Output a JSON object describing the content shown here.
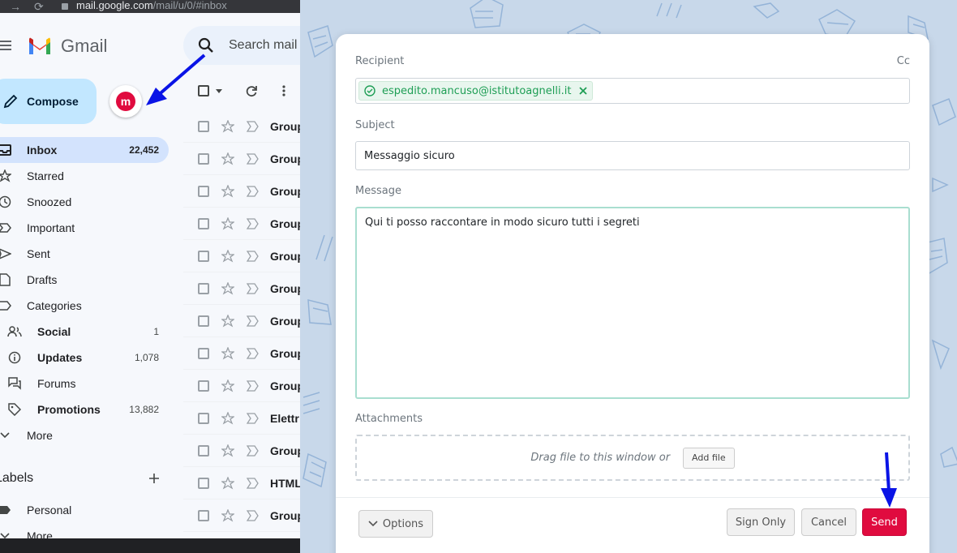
{
  "browser": {
    "url_host": "mail.google.com",
    "url_path": "/mail/u/0/#inbox"
  },
  "gmail": {
    "app_name": "Gmail",
    "search_placeholder": "Search mail",
    "compose_label": "Compose",
    "nav": [
      {
        "label": "Inbox",
        "count": "22,452",
        "icon": "inbox-icon"
      },
      {
        "label": "Starred",
        "count": "",
        "icon": "star-icon"
      },
      {
        "label": "Snoozed",
        "count": "",
        "icon": "clock-icon"
      },
      {
        "label": "Important",
        "count": "",
        "icon": "important-icon"
      },
      {
        "label": "Sent",
        "count": "",
        "icon": "send-icon"
      },
      {
        "label": "Drafts",
        "count": "",
        "icon": "draft-icon"
      },
      {
        "label": "Categories",
        "count": "",
        "icon": "label-icon"
      }
    ],
    "categories": [
      {
        "label": "Social",
        "count": "1",
        "icon": "people-icon"
      },
      {
        "label": "Updates",
        "count": "1,078",
        "icon": "info-icon"
      },
      {
        "label": "Forums",
        "count": "",
        "icon": "forum-icon"
      },
      {
        "label": "Promotions",
        "count": "13,882",
        "icon": "tag-icon"
      }
    ],
    "more_label": "More",
    "labels_title": "Labels",
    "personal_label": "Personal",
    "more_label_2": "More",
    "mail_senders": [
      "Group",
      "Group",
      "Group",
      "Group",
      "Group",
      "Group",
      "Group",
      "Group",
      "Group",
      "Elettr",
      "Group",
      "HTML",
      "Group"
    ]
  },
  "editor": {
    "recipient_label": "Recipient",
    "cc_label": "Cc",
    "recipient_email": "espedito.mancuso@istitutoagnelli.it",
    "subject_label": "Subject",
    "subject_value": "Messaggio sicuro",
    "message_label": "Message",
    "message_value": "Qui ti posso raccontare in modo sicuro tutti i segreti",
    "attachments_label": "Attachments",
    "drop_text": "Drag file to this window or",
    "add_file_label": "Add file",
    "options_label": "Options",
    "sign_only_label": "Sign Only",
    "cancel_label": "Cancel",
    "send_label": "Send"
  },
  "colors": {
    "send_red": "#e00b3f",
    "recipient_green": "#1e9e55",
    "compose_blue": "#c2e7ff",
    "inbox_active": "#d3e3fd",
    "annotation_arrow": "#0a14e6"
  }
}
